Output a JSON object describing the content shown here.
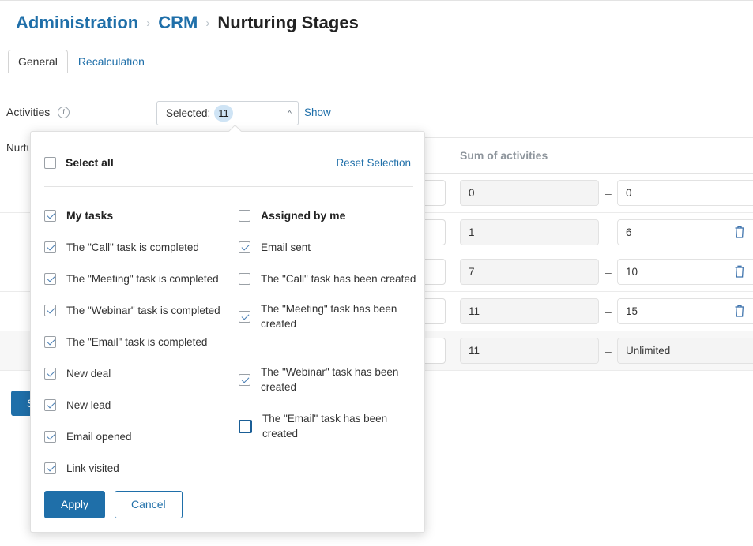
{
  "breadcrumb": {
    "items": [
      {
        "label": "Administration",
        "type": "link"
      },
      {
        "label": "CRM",
        "type": "link"
      },
      {
        "label": "Nurturing Stages",
        "type": "current"
      }
    ],
    "separator": "›"
  },
  "tabs": [
    {
      "label": "General",
      "active": true
    },
    {
      "label": "Recalculation",
      "active": false
    }
  ],
  "toolbar": {
    "activities_label": "Activities",
    "info_icon": "info-icon",
    "selected_prefix": "Selected:",
    "selected_count": "11",
    "chevron": "chevron-up-icon",
    "show_label": "Show",
    "nurturing_label": "Nurtu",
    "save_label": "Save"
  },
  "table": {
    "header_sum": "Sum of activities",
    "dash": "–",
    "rows": [
      {
        "from": "0",
        "to": "0",
        "deletable": false,
        "readonly_to": false
      },
      {
        "from": "1",
        "to": "6",
        "deletable": true,
        "readonly_to": false
      },
      {
        "from": "7",
        "to": "10",
        "deletable": true,
        "readonly_to": false
      },
      {
        "from": "11",
        "to": "15",
        "deletable": true,
        "readonly_to": false
      },
      {
        "from": "11",
        "to": "Unlimited",
        "deletable": false,
        "readonly_to": true
      }
    ]
  },
  "popover": {
    "select_all_label": "Select all",
    "select_all_checked": false,
    "reset_label": "Reset Selection",
    "left_column": [
      {
        "label": "My tasks",
        "checked": true,
        "group": true,
        "two_line": false
      },
      {
        "label": "The \"Call\" task is completed",
        "checked": true,
        "group": false,
        "two_line": false
      },
      {
        "label": "The \"Meeting\" task is completed",
        "checked": true,
        "group": false,
        "two_line": false
      },
      {
        "label": "The \"Webinar\" task is completed",
        "checked": true,
        "group": false,
        "two_line": false
      },
      {
        "label": "The \"Email\" task is completed",
        "checked": true,
        "group": false,
        "two_line": false
      },
      {
        "label": "New deal",
        "checked": true,
        "group": false,
        "two_line": false
      },
      {
        "label": "New lead",
        "checked": true,
        "group": false,
        "two_line": false
      },
      {
        "label": "Email opened",
        "checked": true,
        "group": false,
        "two_line": false
      },
      {
        "label": "Link visited",
        "checked": true,
        "group": false,
        "two_line": false
      }
    ],
    "right_column": [
      {
        "label": "Assigned by me",
        "checked": false,
        "group": true,
        "two_line": false,
        "focused": false
      },
      {
        "label": "Email sent",
        "checked": true,
        "group": false,
        "two_line": false,
        "focused": false
      },
      {
        "label": "The \"Call\" task has been created",
        "checked": false,
        "group": false,
        "two_line": false,
        "focused": false
      },
      {
        "label": "The \"Meeting\" task has been created",
        "checked": true,
        "group": false,
        "two_line": true,
        "focused": false
      },
      {
        "label": "The \"Webinar\" task has been created",
        "checked": true,
        "group": false,
        "two_line": true,
        "focused": false
      },
      {
        "label": "The \"Email\" task has been created",
        "checked": false,
        "group": false,
        "two_line": true,
        "focused": true
      }
    ],
    "apply_label": "Apply",
    "cancel_label": "Cancel"
  },
  "colors": {
    "accent": "#1f6fa9",
    "badge_bg": "#cfe4f5",
    "muted": "#8e959c"
  }
}
